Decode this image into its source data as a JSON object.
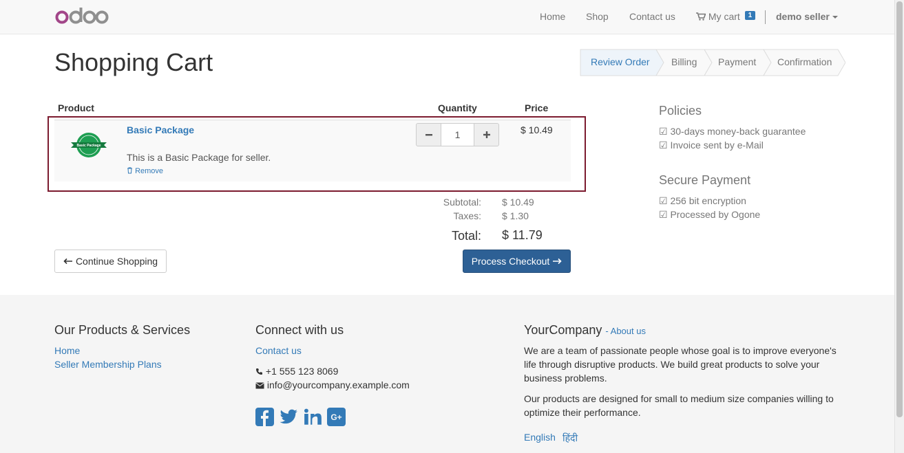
{
  "navbar": {
    "logo_text": "odoo",
    "links": [
      "Home",
      "Shop",
      "Contact us"
    ],
    "cart_label": "My cart",
    "cart_count": "1",
    "user": "demo seller"
  },
  "page": {
    "title": "Shopping Cart"
  },
  "wizard": {
    "steps": [
      "Review Order",
      "Billing",
      "Payment",
      "Confirmation"
    ],
    "active": "Review Order"
  },
  "cart": {
    "headers": {
      "product": "Product",
      "quantity": "Quantity",
      "price": "Price"
    },
    "items": [
      {
        "name": "Basic Package",
        "image_label": "Basic Package",
        "description": "This is a Basic Package for seller.",
        "remove_label": "Remove",
        "quantity": "1",
        "price": "$ 10.49"
      }
    ],
    "subtotal_label": "Subtotal:",
    "subtotal": "$ 10.49",
    "taxes_label": "Taxes:",
    "taxes": "$ 1.30",
    "total_label": "Total:",
    "total": "$ 11.79",
    "continue_label": "Continue Shopping",
    "checkout_label": "Process Checkout"
  },
  "sidebar": {
    "policies_title": "Policies",
    "policies": [
      "30-days money-back guarantee",
      "Invoice sent by e-Mail"
    ],
    "secure_title": "Secure Payment",
    "secure": [
      "256 bit encryption",
      "Processed by Ogone"
    ]
  },
  "footer": {
    "products_title": "Our Products & Services",
    "products_links": [
      "Home",
      "Seller Membership Plans"
    ],
    "connect_title": "Connect with us",
    "connect_link": "Contact us",
    "phone": "+1 555 123 8069",
    "email": "info@yourcompany.example.com",
    "company_title": "YourCompany",
    "about_link": "- About us",
    "about_p1": "We are a team of passionate people whose goal is to improve everyone's life through disruptive products. We build great products to solve your business problems.",
    "about_p2": "Our products are designed for small to medium size companies willing to optimize their performance.",
    "languages": [
      "English",
      "हिंदी"
    ]
  },
  "colors": {
    "primary": "#337ab7",
    "checkout": "#2d6095",
    "highlight": "#7b1a2e",
    "logo": "#a24689"
  },
  "icons": [
    "cart-icon",
    "trash-icon",
    "arrow-left-icon",
    "arrow-right-icon",
    "check-box-icon",
    "phone-icon",
    "envelope-icon",
    "facebook-icon",
    "twitter-icon",
    "linkedin-icon",
    "google-plus-icon"
  ]
}
